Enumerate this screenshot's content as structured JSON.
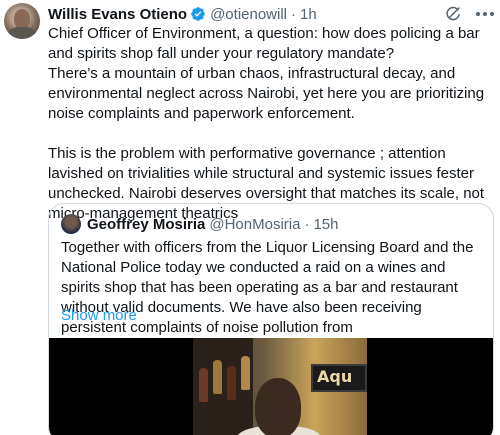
{
  "tweet": {
    "author_name": "Willis Evans Otieno",
    "handle": "@otienowill",
    "separator": "·",
    "time": "1h",
    "paragraphs": [
      "Chief Officer of Environment, a question: how does policing a bar and spirits shop fall under your regulatory mandate?\nThere’s a mountain of urban chaos, infrastructural decay, and environmental neglect across Nairobi, yet here you are prioritizing noise complaints and paperwork enforcement.",
      "This is the problem with performative governance ;  attention lavished on trivialities while structural and systemic issues fester unchecked. Nairobi deserves oversight that matches its scale, not micro-management theatrics"
    ]
  },
  "quoted_tweet": {
    "author_name": "Geoffrey Mosiria",
    "handle": "@HonMosiria",
    "separator": "·",
    "time": "15h",
    "text": "Together with officers from the Liquor Licensing Board and the National Police today we conducted a raid on a wines and spirits shop that has been operating as a bar and restaurant without valid documents. We have also been receiving persistent complaints of noise pollution from",
    "show_more": "Show more",
    "media_sign_text": "Aqu"
  },
  "icons": {
    "verified": "verified-badge-icon",
    "grok": "grok-icon",
    "more": "more-options-icon"
  },
  "colors": {
    "accent": "#1d9bf0",
    "text": "#0f1419",
    "muted": "#536471",
    "border": "#cfd9de"
  }
}
